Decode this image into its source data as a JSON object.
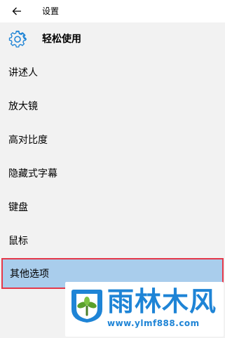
{
  "window": {
    "back_icon": "arrow-left-icon",
    "title": "设置"
  },
  "header": {
    "icon": "gear-icon",
    "title": "轻松使用"
  },
  "menu": {
    "items": [
      {
        "label": "讲述人"
      },
      {
        "label": "放大镜"
      },
      {
        "label": "高对比度"
      },
      {
        "label": "隐藏式字幕"
      },
      {
        "label": "键盘"
      },
      {
        "label": "鼠标"
      },
      {
        "label": "其他选项"
      }
    ],
    "selected_index": 6
  },
  "watermark": {
    "text": "雨林木风",
    "url": "www.ylmf888.com"
  },
  "colors": {
    "accent": "#1e84d6",
    "selection_bg": "#a9cdec",
    "highlight_border": "#e5384a"
  }
}
